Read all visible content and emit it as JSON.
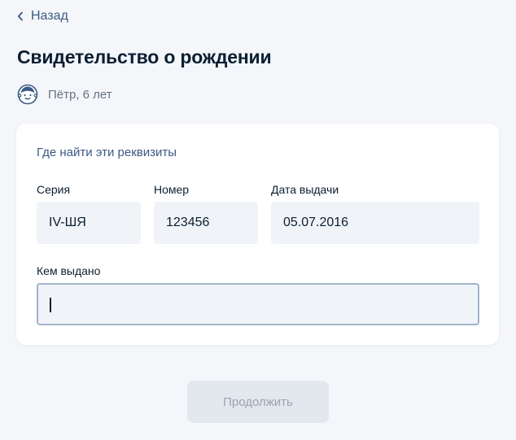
{
  "nav": {
    "back_label": "Назад"
  },
  "page": {
    "title": "Свидетельство о рождении"
  },
  "child": {
    "name": "Пётр, 6 лет"
  },
  "form": {
    "hint_link": "Где найти эти реквизиты",
    "series": {
      "label": "Серия",
      "value": "IV-ШЯ"
    },
    "number": {
      "label": "Номер",
      "value": "123456"
    },
    "issue_date": {
      "label": "Дата выдачи",
      "value": "05.07.2016"
    },
    "issued_by": {
      "label": "Кем выдано",
      "value": ""
    }
  },
  "actions": {
    "continue_label": "Продолжить"
  },
  "colors": {
    "page_background": "#f4f6fa",
    "link": "#3b5a84",
    "text": "#0b1f33",
    "secondary_text": "#66727f",
    "field_background": "#f0f3f7",
    "input_border": "#a3b4cc",
    "disabled_button": "#e3e7ee",
    "disabled_button_text": "#9aa4b2"
  },
  "icons": {
    "back": "chevron-left-icon",
    "child": "child-avatar-icon"
  }
}
